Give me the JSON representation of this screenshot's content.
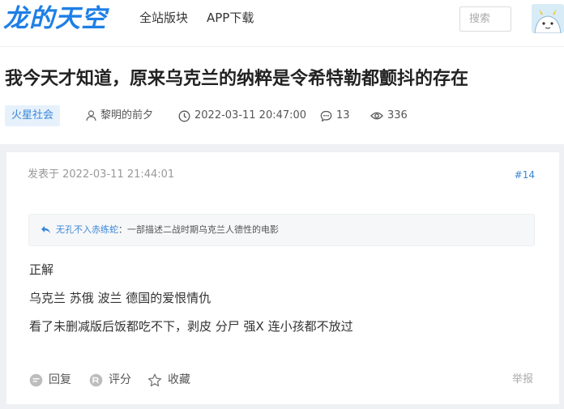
{
  "header": {
    "logo": "龙的天空",
    "nav": [
      "全站版块",
      "APP下载"
    ],
    "search_placeholder": "搜索"
  },
  "thread": {
    "title": "我今天才知道，原来乌克兰的纳粹是令希特勒都颤抖的存在",
    "forum_tag": "火星社会",
    "author": "黎明的前夕",
    "time": "2022-03-11 20:47:00",
    "comments": "13",
    "views": "336"
  },
  "post": {
    "date": "发表于 2022-03-11 21:44:01",
    "floor": "#14",
    "quote": {
      "user": "无孔不入赤练蛇",
      "text": "：一部描述二战时期乌克兰人德性的电影"
    },
    "lines": [
      "正解",
      "乌克兰 苏俄 波兰 德国的爱恨情仇",
      "看了未删减版后饭都吃不下，剥皮 分尸 强X 连小孩都不放过"
    ],
    "actions": {
      "reply": "回复",
      "rate": "评分",
      "favorite": "收藏",
      "report": "举报"
    }
  },
  "colors": {
    "brand": "#1f7fe6",
    "link": "#3a86d8",
    "tag_bg": "#e6f1fc"
  }
}
